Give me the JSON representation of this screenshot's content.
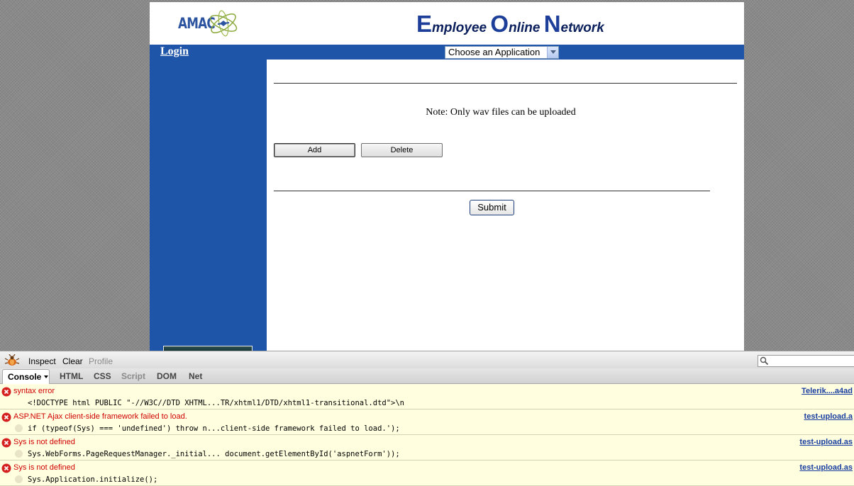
{
  "page": {
    "logo_text": "AMAC",
    "site_title": {
      "e_cap": "E",
      "e_rest": "mployee ",
      "o_cap": "O",
      "o_rest": "nline ",
      "n_cap": "N",
      "n_rest": "etwork"
    },
    "login_label": "Login",
    "app_select_value": "Choose an Application",
    "note": "Note: Only wav files can be uploaded",
    "add_label": "Add",
    "delete_label": "Delete",
    "submit_label": "Submit"
  },
  "firebug": {
    "toolbar": {
      "inspect": "Inspect",
      "clear": "Clear",
      "profile": "Profile"
    },
    "tabs": [
      "Console",
      "HTML",
      "CSS",
      "Script",
      "DOM",
      "Net"
    ],
    "log": [
      {
        "message": "syntax error",
        "source": "Telerik....a4ad",
        "code": "<!DOCTYPE html PUBLIC \"-//W3C//DTD XHTML...TR/xhtml1/DTD/xhtml1-transitional.dtd\">\\n"
      },
      {
        "message": "ASP.NET Ajax client-side framework failed to load.",
        "source": "test-upload.a",
        "code": "if (typeof(Sys) === 'undefined') throw n...client-side framework failed to load.');"
      },
      {
        "message": "Sys is not defined",
        "source": "test-upload.as",
        "code": "Sys.WebForms.PageRequestManager._initial... document.getElementById('aspnetForm'));"
      },
      {
        "message": "Sys is not defined",
        "source": "test-upload.as",
        "code": "Sys.Application.initialize();"
      }
    ]
  },
  "colors": {
    "brand_blue": "#1f55a8",
    "error_red": "#d10000",
    "log_background": "#ffffe0"
  }
}
